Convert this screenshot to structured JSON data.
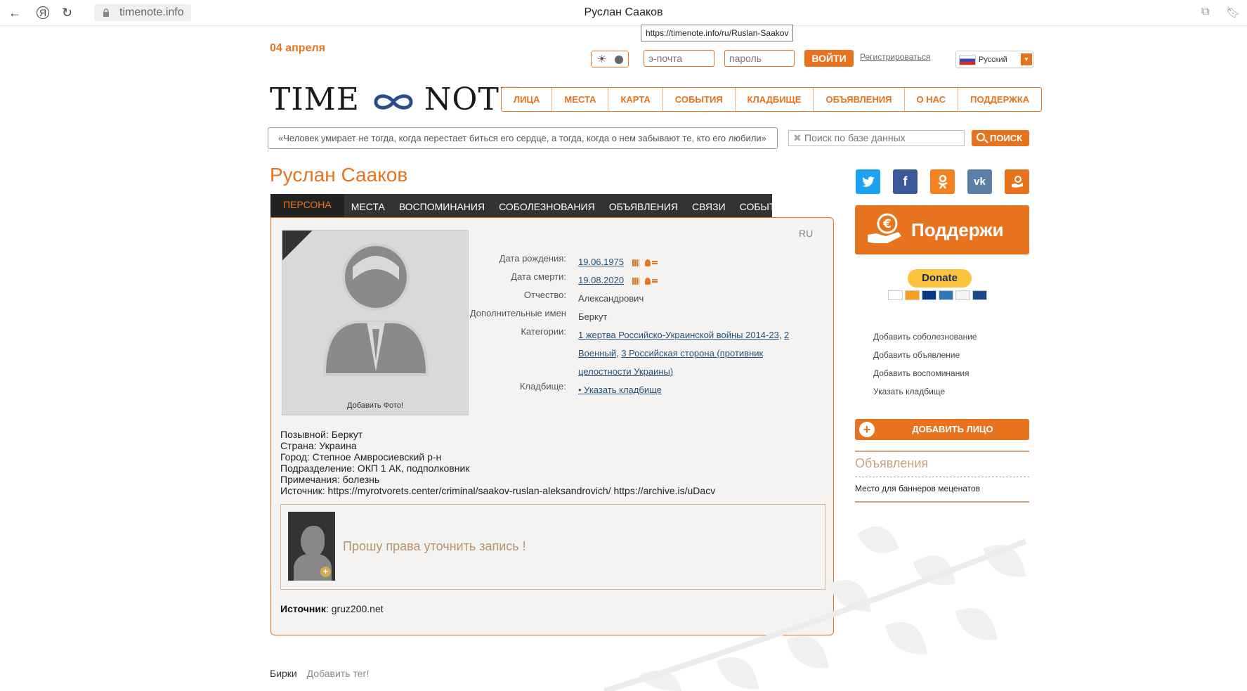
{
  "browser": {
    "url": "timenote.info",
    "title": "Руслан Сааков",
    "tooltip": "https://timenote.info/ru/Ruslan-Saakov",
    "back_icon": "arrow-left-icon",
    "yandex_icon": "yandex-icon",
    "reload_icon": "reload-icon"
  },
  "header": {
    "date": "04 апреля",
    "email_placeholder": "э-почта",
    "password_placeholder": "пароль",
    "login_label": "ВОЙТИ",
    "register_label": "Регистрироваться",
    "language": "Русский",
    "logo_left": "TIME",
    "logo_right": "NOTE"
  },
  "nav": [
    "ЛИЦА",
    "МЕСТА",
    "КАРТА",
    "СОБЫТИЯ",
    "КЛАДБИЩЕ",
    "ОБЪЯВЛЕНИЯ",
    "О НАС",
    "ПОДДЕРЖКА"
  ],
  "quote": "«Человек умирает не тогда, когда перестает биться его сердце, а тогда, когда о нем забывают те, кто его любили»",
  "search": {
    "placeholder": "Поиск по базе данных",
    "button": "ПОИСК"
  },
  "person": {
    "name": "Руслан Сааков",
    "tabs": [
      "ПЕРСОНА",
      "МЕСТА",
      "ВОСПОМИНАНИЯ",
      "СОБОЛЕЗНОВАНИЯ",
      "ОБЪЯВЛЕНИЯ",
      "СВЯЗИ",
      "СОБЫТИЯ"
    ],
    "lang_tag": "RU",
    "add_photo": "Добавить Фото!",
    "birth_label": "Дата рождения:",
    "birth_value": "19.06.1975",
    "death_label": "Дата смерти:",
    "death_value": "19.08.2020",
    "patronymic_label": "Отчество:",
    "patronymic_value": "Александрович",
    "extra_names_label": "Дополнительные имен",
    "extra_names_value": "Беркут",
    "categories_label": "Категории:",
    "category_1": "1 жертва Российско-Украинской войны 2014-23",
    "category_2": "2 Военный",
    "category_3": "3 Российская сторона (противник целостности Украины)",
    "cemetery_label": "Кладбище:",
    "cemetery_value": "• Указать кладбище",
    "bio": [
      "Позывной: Беркут",
      "Страна: Украина",
      "Город: Степное Амвросиевский р-н",
      "Подразделение: ОКП 1 АК, подполковник",
      "Примечания: болезнь",
      "Источник: https://myrotvorets.center/criminal/saakov-ruslan-aleksandrovich/ https://archive.is/uDacv"
    ],
    "request_text": "Прошу права уточнить запись !",
    "source_label": "Источник",
    "source_value": ": gruz200.net"
  },
  "tags": {
    "label": "Бирки",
    "add": "Добавить тег!"
  },
  "sidebar": {
    "social_icons": [
      "twitter-icon",
      "facebook-icon",
      "odnoklassniki-icon",
      "vk-icon",
      "support-hand-icon"
    ],
    "social_colors": [
      "#1da1f2",
      "#3b5998",
      "#f58220",
      "#5d7ea6",
      "#e8731f"
    ],
    "support_label": "Поддержи",
    "donate_label": "Donate",
    "links": [
      "Добавить соболезнование",
      "Добавить объявление",
      "Добавить воспоминания",
      "Указать кладбище"
    ],
    "add_face_label": "ДОБАВИТЬ ЛИЦО",
    "ads_title": "Объявления",
    "ads_text": "Место для баннеров меценатов"
  },
  "colors": {
    "accent": "#e8731f",
    "dark_tab": "#333333",
    "link": "#23527c"
  }
}
